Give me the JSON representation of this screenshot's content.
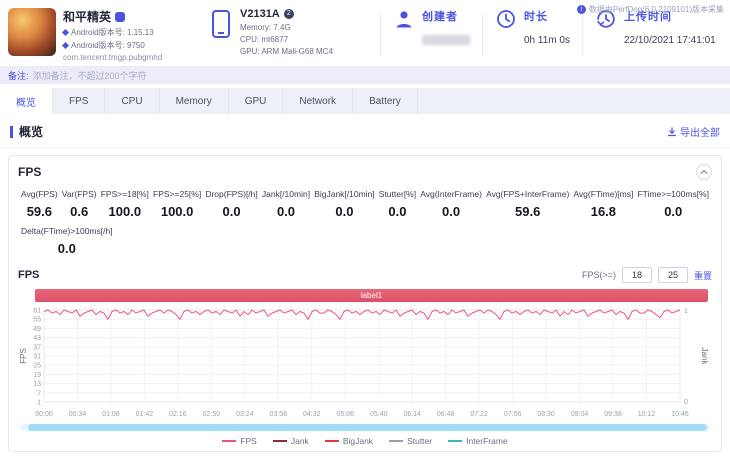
{
  "colors": {
    "accent": "#4a54e1",
    "banner": "#dd4f66",
    "fps_line": "#f0557d",
    "scrollbar": "#a3dcf5"
  },
  "top_note": "数据由PerfDog(6.0.2109101)版本采集",
  "header": {
    "game": {
      "name": "和平精英",
      "version_line1": "Android版本号: 1.15.13",
      "version_line2": "Android版本号: 9750",
      "package": "com.tencent.tmgp.pubgmhd"
    },
    "device": {
      "model": "V2131A",
      "badge": "2",
      "memory": "Memory: 7.4G",
      "cpu": "CPU: mt6877",
      "gpu": "GPU: ARM Mali-G68 MC4"
    },
    "creator_label": "创建者",
    "duration_label": "时长",
    "duration_value": "0h 11m 0s",
    "upload_label": "上传时间",
    "upload_value": "22/10/2021 17:41:01"
  },
  "note_bar": {
    "label": "备注:",
    "text": "添加备注，不超过200个字符"
  },
  "tabs": {
    "items": [
      "概览",
      "FPS",
      "CPU",
      "Memory",
      "GPU",
      "Network",
      "Battery"
    ],
    "active": "概览"
  },
  "overview": {
    "title": "概览",
    "export_link": "导出全部"
  },
  "fps": {
    "card_title": "FPS",
    "stats": [
      {
        "label": "Avg(FPS)",
        "value": "59.6"
      },
      {
        "label": "Var(FPS)",
        "value": "0.6"
      },
      {
        "label": "FPS>=18[%]",
        "value": "100.0"
      },
      {
        "label": "FPS>=25[%]",
        "value": "100.0"
      },
      {
        "label": "Drop(FPS)[/h]",
        "value": "0.0"
      },
      {
        "label": "Jank[/10min]",
        "value": "0.0"
      },
      {
        "label": "BigJank[/10min]",
        "value": "0.0"
      },
      {
        "label": "Stutter[%]",
        "value": "0.0"
      },
      {
        "label": "Avg(InterFrame)",
        "value": "0.0"
      },
      {
        "label": "Avg(FPS+InterFrame)",
        "value": "59.6"
      },
      {
        "label": "Avg(FTime)[ms]",
        "value": "16.8"
      },
      {
        "label": "FTime>=100ms[%]",
        "value": "0.0"
      }
    ],
    "stats_row2": [
      {
        "label": "Delta(FTime)>100ms[/h]",
        "value": "0.0"
      }
    ],
    "chart_header": {
      "title": "FPS",
      "threshold_label": "FPS(>=)",
      "threshold1": "18",
      "threshold2": "25",
      "reset": "重置"
    },
    "banner_label": "label1"
  },
  "chart_data": {
    "type": "line",
    "title": "label1",
    "ylabel_left": "FPS",
    "ylabel_right": "Jank",
    "ylim_left": [
      1,
      61
    ],
    "ylim_right": [
      0,
      1
    ],
    "y_ticks_left": [
      61,
      55,
      49,
      43,
      37,
      31,
      25,
      19,
      13,
      7,
      1
    ],
    "y_ticks_right": [
      "1",
      "0"
    ],
    "x_ticks": [
      "00:00",
      "00:34",
      "01:08",
      "01:42",
      "02:16",
      "02:50",
      "03:24",
      "03:58",
      "04:32",
      "05:06",
      "05:40",
      "06:14",
      "06:48",
      "07:22",
      "07:56",
      "08:30",
      "09:04",
      "09:38",
      "10:12",
      "10:46"
    ],
    "grid": true,
    "legend_position": "bottom",
    "series": [
      {
        "name": "FPS",
        "color": "#f0557d",
        "values": [
          60,
          61,
          59,
          60,
          58,
          61,
          60,
          59,
          61,
          57,
          59,
          60,
          61,
          58,
          60,
          59,
          55,
          60,
          61,
          59,
          60,
          58,
          61,
          59,
          60,
          61,
          57,
          59,
          60,
          61,
          59,
          61,
          60,
          58,
          55,
          60,
          61,
          59,
          60,
          58,
          60,
          61,
          59,
          60,
          58,
          61,
          60,
          59,
          61,
          57,
          60,
          58,
          61,
          59,
          60,
          61,
          57,
          59,
          60,
          61,
          59,
          60,
          61,
          58,
          60,
          59,
          55,
          60,
          61,
          59,
          59,
          61,
          60,
          58,
          55,
          60,
          61,
          59,
          60,
          58,
          60,
          61,
          59,
          60,
          58,
          61,
          60,
          59,
          61,
          57,
          59,
          60,
          61,
          58,
          60,
          59,
          55,
          60,
          61,
          59,
          60,
          58,
          61,
          59,
          60,
          61,
          57,
          59,
          60,
          61,
          59,
          61,
          60,
          58,
          55,
          60,
          61,
          59,
          60,
          58,
          60,
          61,
          59,
          60,
          58,
          61,
          60,
          59,
          61,
          57,
          60,
          58,
          61,
          59,
          60,
          61,
          57,
          59,
          60,
          61,
          59,
          60,
          61,
          58,
          60,
          59,
          55,
          60,
          61,
          59,
          59,
          61,
          60,
          58,
          56,
          60,
          61,
          59,
          60,
          61
        ]
      }
    ],
    "legend": [
      {
        "name": "FPS",
        "color": "#f0557d"
      },
      {
        "name": "Jank",
        "color": "#8c2b3d"
      },
      {
        "name": "BigJank",
        "color": "#e0393e"
      },
      {
        "name": "Stutter",
        "color": "#9aa0a6"
      },
      {
        "name": "InterFrame",
        "color": "#35b8be"
      }
    ]
  }
}
